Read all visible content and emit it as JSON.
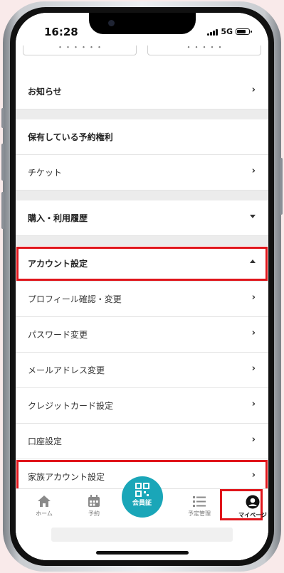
{
  "status_bar": {
    "time": "16:28",
    "network": "5G"
  },
  "top_buttons": {
    "left_label": "・・・・・・",
    "right_label": "・・・・・"
  },
  "menu": {
    "news": "お知らせ",
    "held_rights": "保有している予約権利",
    "ticket": "チケット",
    "purchase_history": "購入・利用履歴",
    "account_settings": "アカウント設定",
    "profile": "プロフィール確認・変更",
    "password": "パスワード変更",
    "email": "メールアドレス変更",
    "credit_card": "クレジットカード設定",
    "bank": "口座設定",
    "family": "家族アカウント設定"
  },
  "tabs": {
    "home": "ホーム",
    "reserve": "予約",
    "member_card": "会員証",
    "schedule": "予定管理",
    "mypage": "マイページ"
  },
  "colors": {
    "highlight": "#e0151b",
    "accent": "#1aa6b8"
  }
}
